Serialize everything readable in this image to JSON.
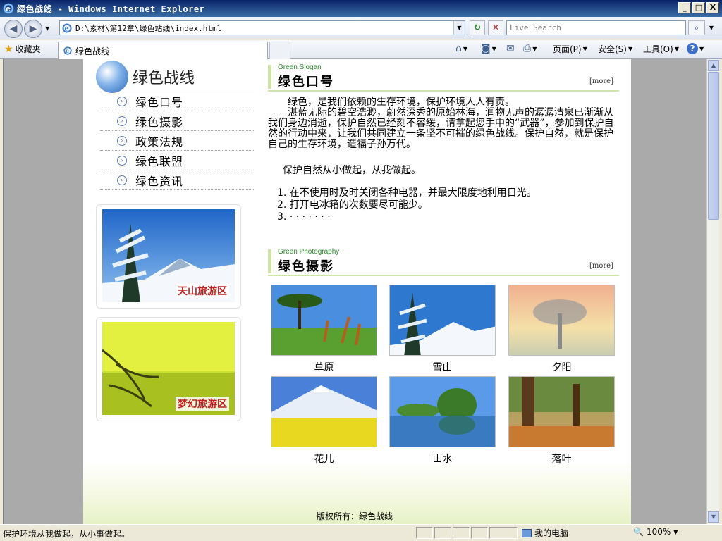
{
  "window": {
    "title": "绿色战线 - Windows Internet Explorer",
    "controls": [
      "_",
      "□",
      "X"
    ]
  },
  "toolbar": {
    "address": "D:\\素材\\第12章\\绿色站线\\index.html",
    "search_placeholder": "Live Search"
  },
  "tabbar": {
    "favorites": "收藏夹",
    "tab_title": "绿色战线",
    "commands": {
      "page": "页面(P)",
      "safety": "安全(S)",
      "tools": "工具(O)",
      "help": "?"
    }
  },
  "site": {
    "logo_text": "绿色战线",
    "nav": [
      {
        "label": "绿色口号"
      },
      {
        "label": "绿色摄影"
      },
      {
        "label": "政策法规"
      },
      {
        "label": "绿色联盟"
      },
      {
        "label": "绿色资讯"
      }
    ],
    "promos": [
      {
        "label": "天山旅游区"
      },
      {
        "label": "梦幻旅游区"
      }
    ],
    "slogan": {
      "en": "Green Slogan",
      "cn": "绿色口号",
      "more": "[more]",
      "p1": "绿色，是我们依赖的生存环境，保护环境人人有责。",
      "p2": "湛蓝无际的碧空浩渺，蔚然深秀的原始林海，润物无声的潺潺清泉已渐渐从我们身边消逝，保护自然已经刻不容缓，请拿起您手中的“武器”，参加到保护自然的行动中来，让我们共同建立一条坚不可摧的绿色战线。保护自然，就是保护自己的生存环境，造福子孙万代。",
      "p3": "保护自然从小做起，从我做起。",
      "list": [
        "1.  在不使用时及时关闭各种电器，并最大限度地利用日光。",
        "2.  打开电冰箱的次数要尽可能少。",
        "3.  · · · · · · ·"
      ]
    },
    "photography": {
      "en": "Green Photography",
      "cn": "绿色摄影",
      "more": "[more]",
      "photos": [
        {
          "caption": "草原"
        },
        {
          "caption": "雪山"
        },
        {
          "caption": "夕阳"
        },
        {
          "caption": "花儿"
        },
        {
          "caption": "山水"
        },
        {
          "caption": "落叶"
        }
      ]
    },
    "copyright": "版权所有：绿色战线"
  },
  "statusbar": {
    "text": "保护环境从我做起，从小事做起。",
    "zone": "我的电脑",
    "zoom": "100%"
  }
}
